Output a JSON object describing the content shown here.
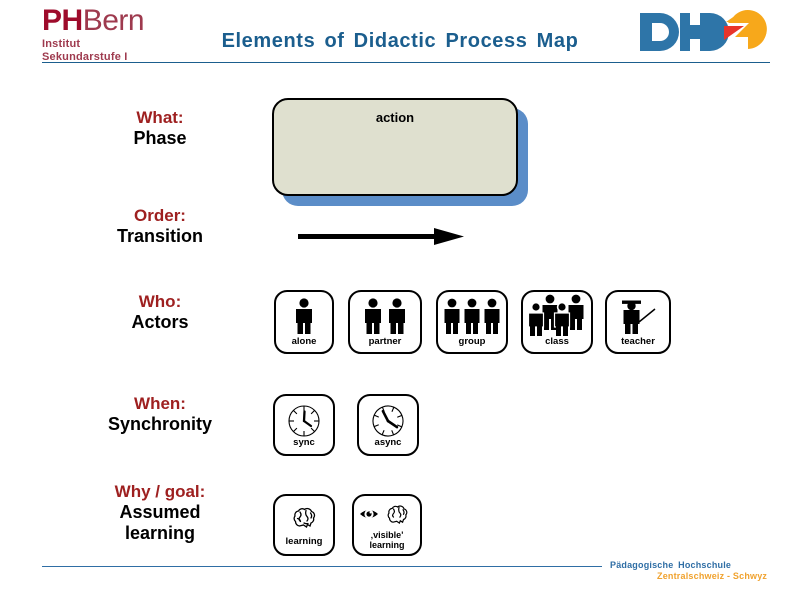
{
  "header": {
    "logo_left": {
      "ph": "PH",
      "bern": "Bern",
      "line1": "Institut",
      "line2": "Sekundarstufe I"
    },
    "title": "Elements of Didactic Process Map",
    "logo_right_name": "PHZ",
    "title_color": "#1b5e8e",
    "brand_red": "#9e0b2b"
  },
  "footer": {
    "line1": "Pädagogische Hochschule",
    "line2": "Zentralschweiz - Schwyz",
    "line1_color": "#2f6ea5",
    "line2_color": "#f0a22e"
  },
  "rows": [
    {
      "question": "What:",
      "answer": "Phase"
    },
    {
      "question": "Order:",
      "answer": "Transition"
    },
    {
      "question": "Who:",
      "answer": "Actors"
    },
    {
      "question": "When:",
      "answer": "Synchronity"
    },
    {
      "question": "Why / goal:",
      "answer": "Assumed\nlearning"
    }
  ],
  "phase": {
    "label": "action",
    "fill": "#dfe0cf",
    "shadow": "#5b8dc8",
    "border": "#000000"
  },
  "transition": {
    "icon": "right-arrow-icon"
  },
  "actors": [
    {
      "label": "alone",
      "icon": "person-single-icon"
    },
    {
      "label": "partner",
      "icon": "person-pair-icon"
    },
    {
      "label": "group",
      "icon": "person-trio-icon"
    },
    {
      "label": "class",
      "icon": "person-crowd-icon"
    },
    {
      "label": "teacher",
      "icon": "teacher-icon"
    }
  ],
  "synchronity": [
    {
      "label": "sync",
      "icon": "clock-upright-icon"
    },
    {
      "label": "async",
      "icon": "clock-tilted-icon"
    }
  ],
  "learning": [
    {
      "label": "learning",
      "icon": "brain-icon"
    },
    {
      "label": "‚visible'\nlearning",
      "icon": "eye-brain-icon"
    }
  ]
}
